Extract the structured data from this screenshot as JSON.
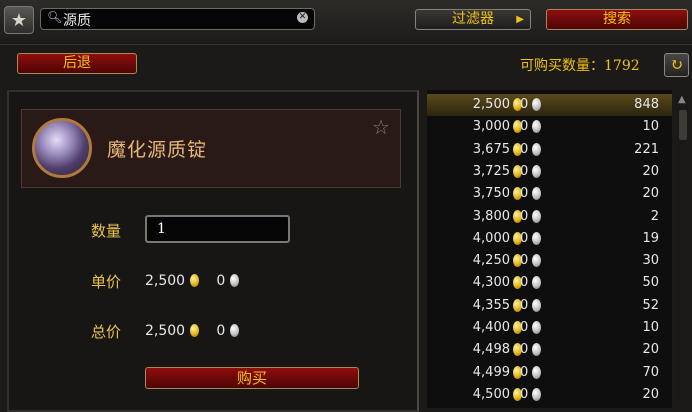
{
  "header": {
    "search_value": "源质",
    "filter_label": "过滤器",
    "search_button": "搜索",
    "back_button": "后退",
    "available_label": "可购买数量：",
    "available_count": "1792"
  },
  "item": {
    "name": "魔化源质锭",
    "quantity_label": "数量",
    "quantity_value": "1",
    "unit_price_label": "单价",
    "unit_price_gold": "2,500",
    "unit_price_silver": "0",
    "total_price_label": "总价",
    "total_price_gold": "2,500",
    "total_price_silver": "0",
    "buy_button": "购买"
  },
  "listings": [
    {
      "gold": "2,500",
      "silver": "0",
      "qty": "848",
      "selected": true
    },
    {
      "gold": "3,000",
      "silver": "0",
      "qty": "10"
    },
    {
      "gold": "3,675",
      "silver": "0",
      "qty": "221"
    },
    {
      "gold": "3,725",
      "silver": "0",
      "qty": "20"
    },
    {
      "gold": "3,750",
      "silver": "0",
      "qty": "20"
    },
    {
      "gold": "3,800",
      "silver": "0",
      "qty": "2"
    },
    {
      "gold": "4,000",
      "silver": "0",
      "qty": "19"
    },
    {
      "gold": "4,250",
      "silver": "0",
      "qty": "30"
    },
    {
      "gold": "4,300",
      "silver": "0",
      "qty": "50"
    },
    {
      "gold": "4,355",
      "silver": "0",
      "qty": "52"
    },
    {
      "gold": "4,400",
      "silver": "0",
      "qty": "10"
    },
    {
      "gold": "4,498",
      "silver": "0",
      "qty": "20"
    },
    {
      "gold": "4,499",
      "silver": "0",
      "qty": "70"
    },
    {
      "gold": "4,500",
      "silver": "0",
      "qty": "20"
    }
  ],
  "icons": {
    "favorites": "star-icon",
    "search": "magnifier-icon",
    "clear": "clear-icon",
    "filter_arrow": "arrow-right-icon",
    "refresh": "refresh-icon",
    "item": "ingot-icon",
    "favorite_item": "star-outline-icon",
    "gold": "gold-coin-icon",
    "silver": "silver-coin-icon"
  },
  "colors": {
    "accent_gold": "#f2c21a",
    "button_red": "#8f0d0d",
    "selected_row": "#5a4a1a"
  }
}
